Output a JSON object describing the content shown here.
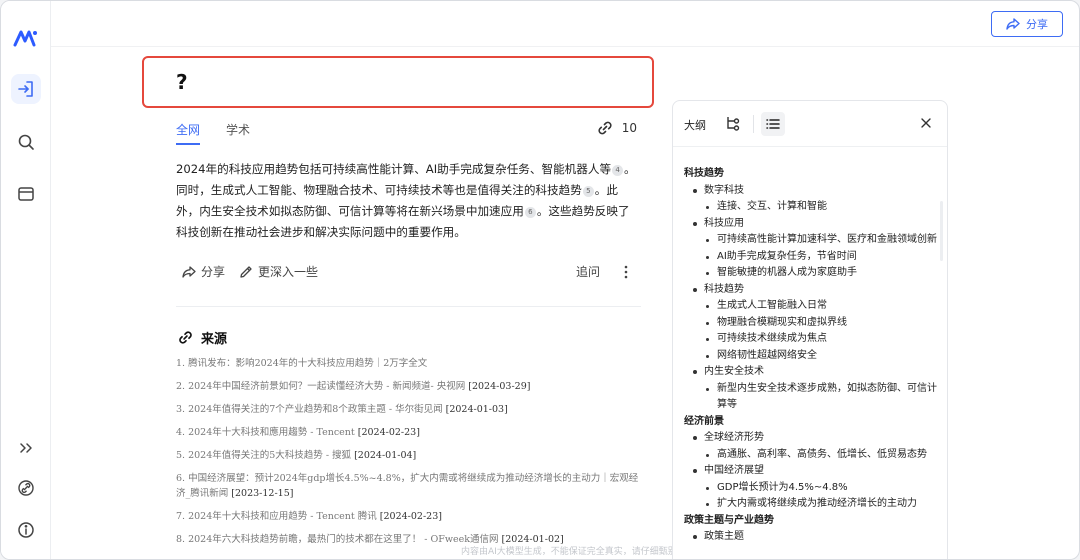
{
  "header": {
    "share_label": "分享"
  },
  "question": "?",
  "tabs": [
    {
      "label": "全网",
      "active": true
    },
    {
      "label": "学术",
      "active": false
    }
  ],
  "ref_count": "10",
  "answer": {
    "p1": "2024年的科技应用趋势包括可持续高性能计算、AI助手完成复杂任务、智能机器人等",
    "c1": "4",
    "p2": "。同时，生成式人工智能、物理融合技术、可持续技术等也是值得关注的科技趋势",
    "c2": "5",
    "p3": "。此外，内生安全技术如拟态防御、可信计算等将在新兴场景中加速应用",
    "c3": "6",
    "p4": "。这些趋势反映了科技创新在推动社会进步和解决实际问题中的重要作用。"
  },
  "actions": {
    "share": "分享",
    "deeper": "更深入一些",
    "followup": "追问"
  },
  "sources_title": "来源",
  "sources": [
    {
      "text": "1. 腾讯发布：影响2024年的十大科技应用趋势｜2万字全文",
      "date": ""
    },
    {
      "text": "2. 2024年中国经济前景如何？一起读懂经济大势 - 新闻频道- 央视网 ",
      "date": "[2024-03-29]"
    },
    {
      "text": "3. 2024年值得关注的7个产业趋势和8个政策主题 - 华尔街见闻 ",
      "date": "[2024-01-03]"
    },
    {
      "text": "4. 2024年十大科技和應用趨勢 - Tencent ",
      "date": "[2024-02-23]"
    },
    {
      "text": "5. 2024年值得关注的5大科技趋势 - 搜狐 ",
      "date": "[2024-01-04]"
    },
    {
      "text": "6. 中国经济展望：预计2024年gdp增长4.5%~4.8%，扩大内需或将继续成为推动经济增长的主动力｜宏观经济_腾讯新闻 ",
      "date": "[2023-12-15]"
    },
    {
      "text": "7. 2024年十大科技和应用趋势 - Tencent 腾讯 ",
      "date": "[2024-02-23]"
    },
    {
      "text": "8. 2024年六大科技趋势前瞻，最热门的技术都在这里了！ - OFweek通信网 ",
      "date": "[2024-01-02]"
    }
  ],
  "footer_note": "内容由AI大模型生成，不能保证完全真实，请仔细甄别",
  "outline": {
    "title": "大纲",
    "items": [
      {
        "level": 1,
        "text": "科技趋势"
      },
      {
        "level": 2,
        "text": "数字科技"
      },
      {
        "level": 3,
        "text": "连接、交互、计算和智能"
      },
      {
        "level": 2,
        "text": "科技应用"
      },
      {
        "level": 3,
        "text": "可持续高性能计算加速科学、医疗和金融领域创新"
      },
      {
        "level": 3,
        "text": "AI助手完成复杂任务，节省时间"
      },
      {
        "level": 3,
        "text": "智能敏捷的机器人成为家庭助手"
      },
      {
        "level": 2,
        "text": "科技趋势"
      },
      {
        "level": 3,
        "text": "生成式人工智能融入日常"
      },
      {
        "level": 3,
        "text": "物理融合模糊现实和虚拟界线"
      },
      {
        "level": 3,
        "text": "可持续技术继续成为焦点"
      },
      {
        "level": 3,
        "text": "网络韧性超越网络安全"
      },
      {
        "level": 2,
        "text": "内生安全技术"
      },
      {
        "level": 3,
        "text": "新型内生安全技术逐步成熟，如拟态防御、可信计算等"
      },
      {
        "level": 1,
        "text": "经济前景"
      },
      {
        "level": 2,
        "text": "全球经济形势"
      },
      {
        "level": 3,
        "text": "高通胀、高利率、高债务、低增长、低贸易态势"
      },
      {
        "level": 2,
        "text": "中国经济展望"
      },
      {
        "level": 3,
        "text": "GDP增长预计为4.5%~4.8%"
      },
      {
        "level": 3,
        "text": "扩大内需或将继续成为推动经济增长的主动力"
      },
      {
        "level": 1,
        "text": "政策主题与产业趋势"
      },
      {
        "level": 2,
        "text": "政策主题"
      }
    ]
  },
  "colors": {
    "accent": "#3e6cf4",
    "highlight_border": "#e5483c"
  }
}
